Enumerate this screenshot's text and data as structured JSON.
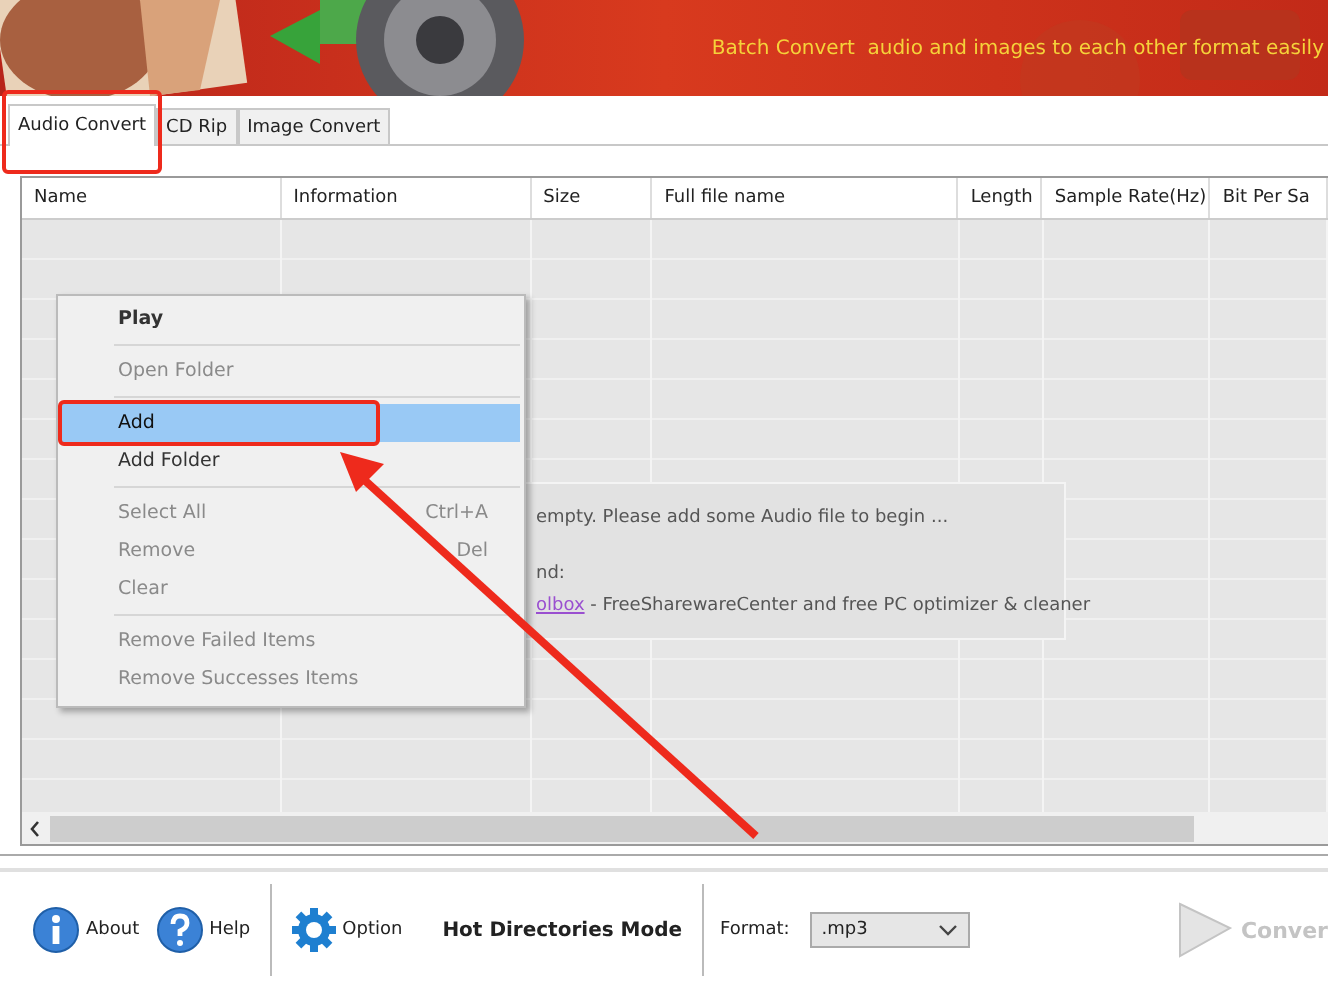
{
  "banner": {
    "tagline": "Batch Convert  audio and images to each other format easily"
  },
  "tabs": [
    {
      "label": "Audio Convert",
      "selected": true,
      "annotated": true
    },
    {
      "label": "CD Rip",
      "selected": false,
      "annotated": false
    },
    {
      "label": "Image Convert",
      "selected": false,
      "annotated": false
    }
  ],
  "table": {
    "columns": [
      "Name",
      "Information",
      "Size",
      "Full file name",
      "Length",
      "Sample Rate(Hz)",
      "Bit Per Sa"
    ]
  },
  "empty_message": {
    "line_1": "empty. Please add some Audio file to begin ...",
    "line_2": "nd:",
    "link": "olbox",
    "line_3": " - FreeSharewareCenter and free PC optimizer & cleaner"
  },
  "context_menu": {
    "items": [
      {
        "kind": "item",
        "label": "Play",
        "disabled": false,
        "selected": false,
        "bold": true,
        "annotated": false
      },
      {
        "kind": "separator"
      },
      {
        "kind": "item",
        "label": "Open Folder",
        "disabled": true,
        "selected": false,
        "bold": false,
        "annotated": false
      },
      {
        "kind": "separator"
      },
      {
        "kind": "item",
        "label": "Add",
        "disabled": false,
        "selected": true,
        "bold": false,
        "annotated": true
      },
      {
        "kind": "item",
        "label": "Add Folder",
        "disabled": false,
        "selected": false,
        "bold": false,
        "annotated": false
      },
      {
        "kind": "separator"
      },
      {
        "kind": "item",
        "label": "Select All",
        "shortcut": "Ctrl+A",
        "disabled": true,
        "selected": false,
        "bold": false,
        "annotated": false
      },
      {
        "kind": "item",
        "label": "Remove",
        "shortcut": "Del",
        "disabled": true,
        "selected": false,
        "bold": false,
        "annotated": false
      },
      {
        "kind": "item",
        "label": "Clear",
        "disabled": true,
        "selected": false,
        "bold": false,
        "annotated": false
      },
      {
        "kind": "separator"
      },
      {
        "kind": "item",
        "label": "Remove Failed Items",
        "disabled": true,
        "selected": false,
        "bold": false,
        "annotated": false
      },
      {
        "kind": "item",
        "label": "Remove Successes Items",
        "disabled": true,
        "selected": false,
        "bold": false,
        "annotated": false
      }
    ]
  },
  "callout_arrow": true,
  "toolbar": {
    "about": "About",
    "help": "Help",
    "option": "Option",
    "mode": "Hot Directories Mode",
    "format_label": "Format:",
    "format_value": ".mp3",
    "convert": "Conver",
    "convert_disabled": true
  }
}
